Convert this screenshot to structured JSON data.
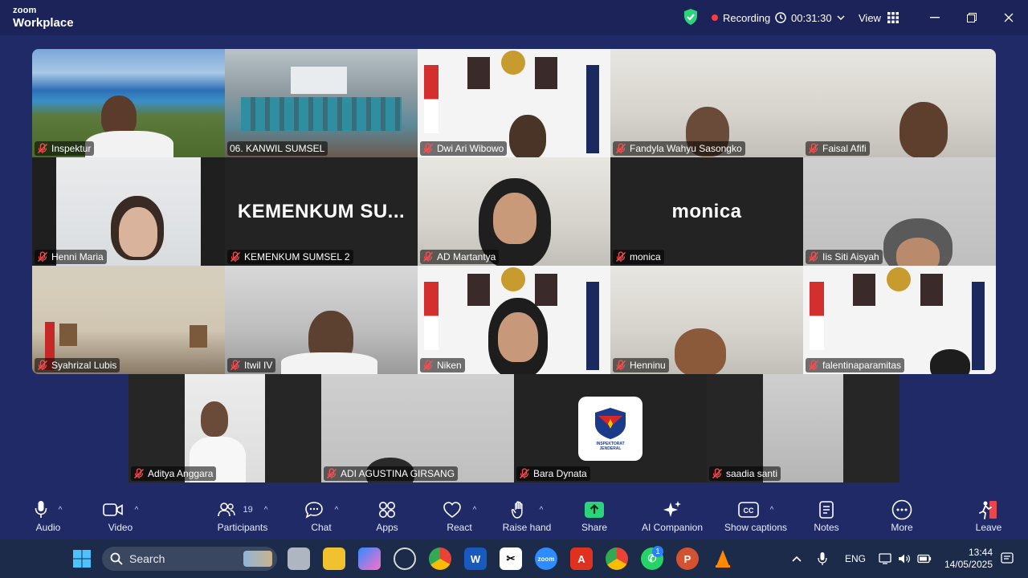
{
  "window": {
    "brand_line1": "zoom",
    "brand_line2": "Workplace",
    "recording_label": "Recording",
    "timer": "00:31:30",
    "view_label": "View",
    "status_colors": {
      "recording_dot": "#ff3b3b",
      "encryption_shield": "#2bd47b"
    }
  },
  "participants_grid": [
    {
      "name": "Inspektur",
      "scene": "beach",
      "active": false
    },
    {
      "name": "06. KANWIL SUMSEL",
      "scene": "conference-room",
      "active": true
    },
    {
      "name": "Dwi Ari Wibowo",
      "scene": "official-backdrop",
      "active": false
    },
    {
      "name": "Fandyla Wahyu Sasongko",
      "scene": "office",
      "active": false
    },
    {
      "name": "Faisal Afifi",
      "scene": "office",
      "active": false
    },
    {
      "name": "Henni Maria",
      "scene": "office",
      "active": false
    },
    {
      "name": "KEMENKUM SUMSEL 2",
      "display_name": "KEMENKUM  SU...",
      "scene": "video-off",
      "active": false
    },
    {
      "name": "AD Martantya",
      "scene": "office",
      "active": false
    },
    {
      "name": "monica",
      "display_name": "monica",
      "scene": "video-off",
      "active": false
    },
    {
      "name": "Iis Siti Aisyah",
      "scene": "office",
      "active": false
    },
    {
      "name": "Syahrizal Lubis",
      "scene": "government-office",
      "active": false
    },
    {
      "name": "Itwil IV",
      "scene": "workspace",
      "active": false
    },
    {
      "name": "Niken",
      "scene": "official-backdrop",
      "active": false
    },
    {
      "name": "Henninu",
      "scene": "office",
      "active": false
    },
    {
      "name": "falentinaparamitas",
      "scene": "official-backdrop",
      "active": false
    },
    {
      "name": "Aditya Anggara",
      "scene": "office",
      "active": false
    },
    {
      "name": "ADI AGUSTINA GIRSANG",
      "scene": "ceiling",
      "active": false
    },
    {
      "name": "Bara Dynata",
      "scene": "logo",
      "logo_text": "INSPEKTORAT JENDERAL",
      "active": false
    },
    {
      "name": "saadia santi",
      "scene": "wall",
      "active": false
    }
  ],
  "toolbar": {
    "audio": "Audio",
    "video": "Video",
    "participants": "Participants",
    "participants_count": "19",
    "chat": "Chat",
    "apps": "Apps",
    "react": "React",
    "raise_hand": "Raise hand",
    "share": "Share",
    "ai_companion": "AI Companion",
    "show_captions": "Show captions",
    "notes": "Notes",
    "more": "More",
    "leave": "Leave"
  },
  "taskbar": {
    "search_placeholder": "Search",
    "language": "ENG",
    "time": "13:44",
    "date": "14/05/2025",
    "whatsapp_badge": "1",
    "icons": [
      "start-icon",
      "search-icon",
      "task-view-icon",
      "file-explorer-icon",
      "copilot-icon",
      "app-icon",
      "chrome-icon",
      "word-icon",
      "capcut-icon",
      "zoom-icon",
      "acrobat-icon",
      "chrome-profile-icon",
      "whatsapp-icon",
      "powerpoint-icon",
      "vlc-icon"
    ]
  }
}
